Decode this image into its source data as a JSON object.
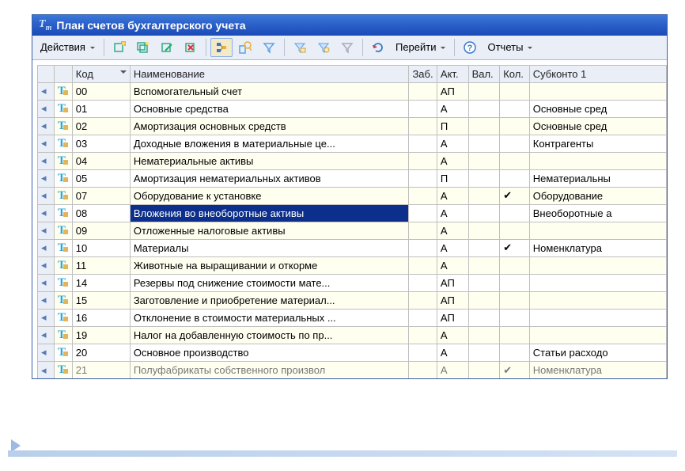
{
  "title": "План счетов бухгалтерского учета",
  "toolbar": {
    "actions": "Действия",
    "goto": "Перейти",
    "reports": "Отчеты"
  },
  "columns": {
    "mark": "",
    "tt": "",
    "code": "Код",
    "name": "Наименование",
    "zab": "Заб.",
    "akt": "Акт.",
    "val": "Вал.",
    "kol": "Кол.",
    "sub1": "Субконто 1"
  },
  "rows": [
    {
      "code": "00",
      "name": "Вспомогательный счет",
      "akt": "АП",
      "kol": "",
      "sub1": ""
    },
    {
      "code": "01",
      "name": "Основные средства",
      "akt": "А",
      "kol": "",
      "sub1": "Основные сред"
    },
    {
      "code": "02",
      "name": "Амортизация основных средств",
      "akt": "П",
      "kol": "",
      "sub1": "Основные сред"
    },
    {
      "code": "03",
      "name": "Доходные вложения в материальные це...",
      "akt": "А",
      "kol": "",
      "sub1": "Контрагенты"
    },
    {
      "code": "04",
      "name": "Нематериальные активы",
      "akt": "А",
      "kol": "",
      "sub1": ""
    },
    {
      "code": "05",
      "name": "Амортизация нематериальных активов",
      "akt": "П",
      "kol": "",
      "sub1": "Нематериальны"
    },
    {
      "code": "07",
      "name": "Оборудование к установке",
      "akt": "А",
      "kol": "✔",
      "sub1": "Оборудование"
    },
    {
      "code": "08",
      "name": "Вложения во внеоборотные активы",
      "akt": "А",
      "kol": "",
      "sub1": "Внеоборотные а",
      "selected": true
    },
    {
      "code": "09",
      "name": "Отложенные налоговые активы",
      "akt": "А",
      "kol": "",
      "sub1": ""
    },
    {
      "code": "10",
      "name": "Материалы",
      "akt": "А",
      "kol": "✔",
      "sub1": "Номенклатура"
    },
    {
      "code": "11",
      "name": "Животные на выращивании и откорме",
      "akt": "А",
      "kol": "",
      "sub1": ""
    },
    {
      "code": "14",
      "name": "Резервы под снижение стоимости мате...",
      "akt": "АП",
      "kol": "",
      "sub1": ""
    },
    {
      "code": "15",
      "name": "Заготовление и приобретение материал...",
      "akt": "АП",
      "kol": "",
      "sub1": ""
    },
    {
      "code": "16",
      "name": "Отклонение в стоимости материальных ...",
      "akt": "АП",
      "kol": "",
      "sub1": ""
    },
    {
      "code": "19",
      "name": "Налог на добавленную стоимость по пр...",
      "akt": "А",
      "kol": "",
      "sub1": ""
    },
    {
      "code": "20",
      "name": "Основное производство",
      "akt": "А",
      "kol": "",
      "sub1": "Статьи расходо"
    },
    {
      "code": "21",
      "name": "Полуфабрикаты собственного произвол",
      "akt": "А",
      "kol": "✔",
      "sub1": "Номенклатура",
      "partial": true
    }
  ]
}
